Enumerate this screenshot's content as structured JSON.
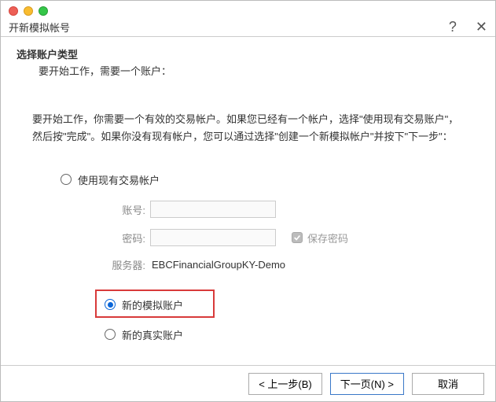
{
  "window": {
    "title": "开新模拟帐号"
  },
  "header": {
    "title": "选择账户类型",
    "subtitle": "要开始工作，需要一个账户："
  },
  "instructions": "要开始工作，你需要一个有效的交易帐户。如果您已经有一个帐户，选择\"使用现有交易账户\"，然后按\"完成\"。如果你没有现有帐户，您可以通过选择\"创建一个新模拟帐户\"并按下\"下一步\"：",
  "options": {
    "existing": "使用现有交易帐户",
    "new_demo": "新的模拟账户",
    "new_real": "新的真实账户",
    "selected": "new_demo"
  },
  "form": {
    "login_label": "账号:",
    "password_label": "密码:",
    "login_value": "",
    "password_value": "",
    "save_password_label": "保存密码",
    "save_password_checked": true,
    "server_label": "服务器:",
    "server_value": "EBCFinancialGroupKY-Demo"
  },
  "footer": {
    "back": "< 上一步(B)",
    "next": "下一页(N) >",
    "cancel": "取消"
  }
}
